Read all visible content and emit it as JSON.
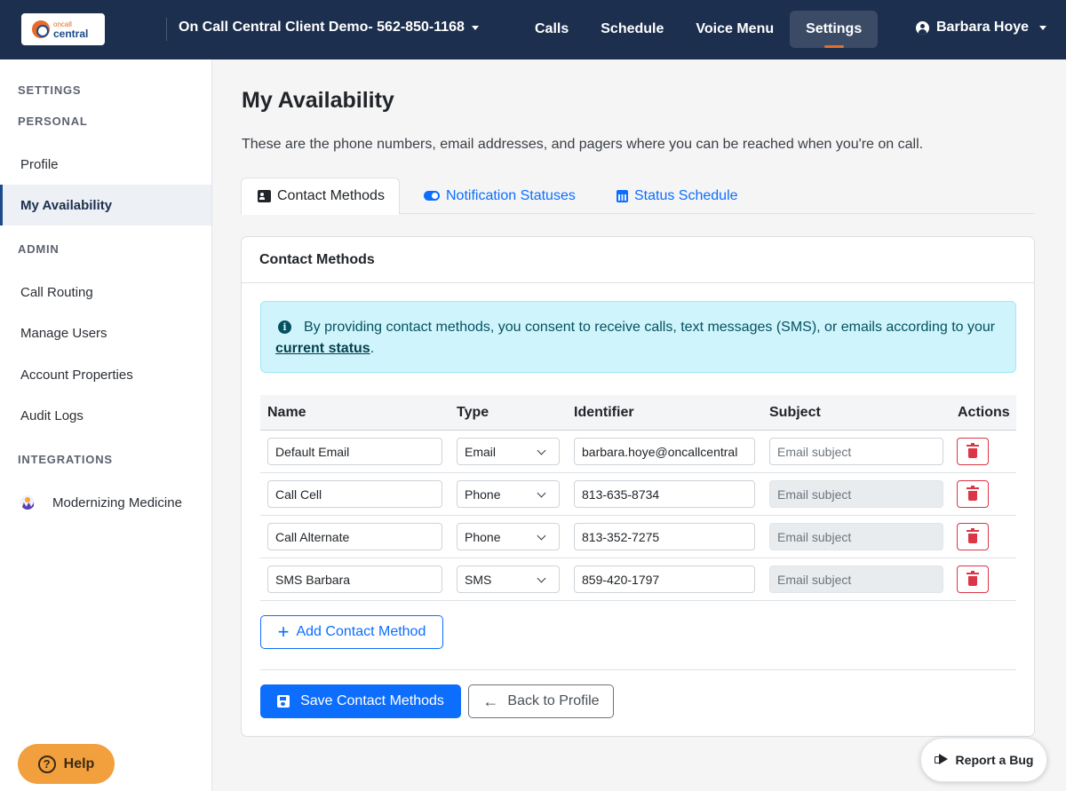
{
  "header": {
    "logo_line1": "oncall",
    "logo_line2": "central",
    "org_name": "On Call Central Client Demo- 562-850-1168",
    "nav": [
      {
        "label": "Calls",
        "active": false
      },
      {
        "label": "Schedule",
        "active": false
      },
      {
        "label": "Voice Menu",
        "active": false
      },
      {
        "label": "Settings",
        "active": true
      }
    ],
    "user_name": "Barbara Hoye",
    "accent_color": "#e86b2a",
    "bg_color": "#1c2f4f"
  },
  "sidebar": {
    "section_settings": "SETTINGS",
    "section_personal": "PERSONAL",
    "personal_items": [
      "Profile",
      "My Availability"
    ],
    "section_admin": "ADMIN",
    "admin_items": [
      "Call Routing",
      "Manage Users",
      "Account Properties",
      "Audit Logs"
    ],
    "section_integrations": "INTEGRATIONS",
    "integration_items": [
      "Modernizing Medicine"
    ],
    "active_item": "My Availability",
    "help_label": "Help"
  },
  "main": {
    "title": "My Availability",
    "description": "These are the phone numbers, email addresses, and pagers where you can be reached when you're on call.",
    "tabs": [
      {
        "label": "Contact Methods",
        "icon": "contact-card-icon",
        "active": true
      },
      {
        "label": "Notification Statuses",
        "icon": "toggle-icon",
        "active": false
      },
      {
        "label": "Status Schedule",
        "icon": "calendar-icon",
        "active": false
      }
    ],
    "card_title": "Contact Methods",
    "alert_text": "By providing contact methods, you consent to receive calls, text messages (SMS), or emails according to your",
    "alert_link": "current status",
    "alert_end": ".",
    "table": {
      "columns": [
        "Name",
        "Type",
        "Identifier",
        "Subject",
        "Actions"
      ],
      "subject_placeholder": "Email subject",
      "rows": [
        {
          "name": "Default Email",
          "type": "Email",
          "identifier": "barbara.hoye@oncallcentral",
          "subject_enabled": true
        },
        {
          "name": "Call Cell",
          "type": "Phone",
          "identifier": "813-635-8734",
          "subject_enabled": false
        },
        {
          "name": "Call Alternate",
          "type": "Phone",
          "identifier": "813-352-7275",
          "subject_enabled": false
        },
        {
          "name": "SMS Barbara",
          "type": "SMS",
          "identifier": "859-420-1797",
          "subject_enabled": false
        }
      ]
    },
    "add_label": "Add Contact Method",
    "save_label": "Save Contact Methods",
    "back_label": "Back to Profile",
    "primary_color": "#0d6efd",
    "danger_color": "#dc3545"
  },
  "report_bug_label": "Report a Bug"
}
